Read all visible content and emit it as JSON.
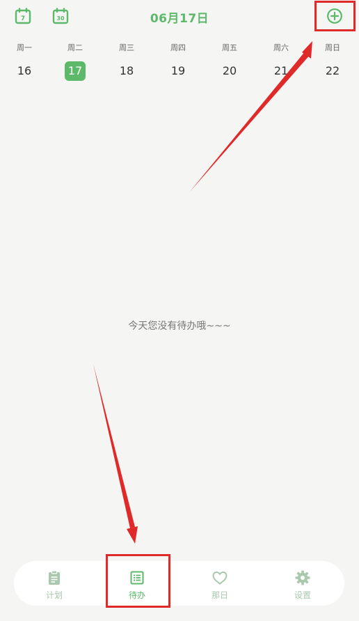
{
  "header": {
    "title": "06月17日",
    "week_view_icon_text": "7",
    "month_view_icon_text": "30"
  },
  "week": {
    "labels": [
      "周一",
      "周二",
      "周三",
      "周四",
      "周五",
      "周六",
      "周日"
    ],
    "days": [
      "16",
      "17",
      "18",
      "19",
      "20",
      "21",
      "22"
    ],
    "selected_index": 1
  },
  "empty_message": "今天您没有待办哦~~~",
  "bottom_nav": {
    "items": [
      {
        "label": "计划",
        "icon": "clipboard-icon"
      },
      {
        "label": "待办",
        "icon": "list-icon"
      },
      {
        "label": "那日",
        "icon": "heart-icon"
      },
      {
        "label": "设置",
        "icon": "gear-icon"
      }
    ],
    "active_index": 1
  },
  "colors": {
    "accent": "#5cb96a",
    "inactive": "#a9c8ae",
    "background": "#f5f5f4",
    "annotation_red": "#e02a2a"
  }
}
